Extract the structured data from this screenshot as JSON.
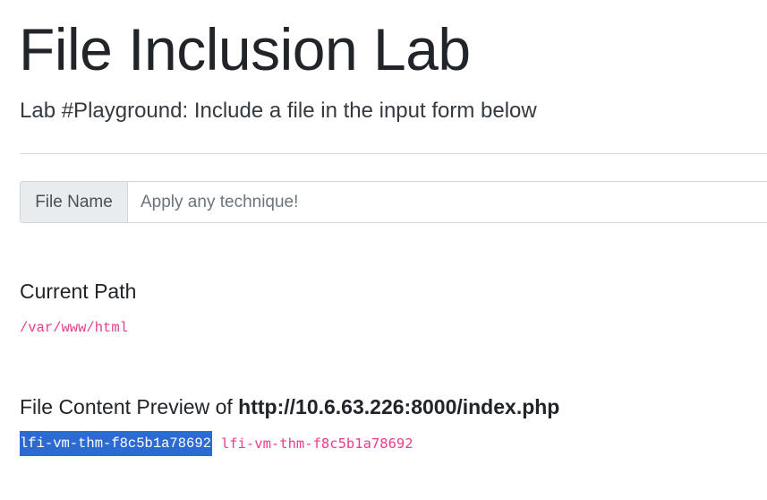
{
  "header": {
    "title": "File Inclusion Lab",
    "subtitle": "Lab #Playground: Include a file in the input form below"
  },
  "form": {
    "label": "File Name",
    "input_value": "",
    "placeholder": "Apply any technique!"
  },
  "current_path": {
    "heading": "Current Path",
    "value": "/var/www/html"
  },
  "preview": {
    "heading_prefix": "File Content Preview of",
    "url": "http://10.6.63.226:8000/index.php",
    "selected_text": "lfi-vm-thm-f8c5b1a78692",
    "content_text": "lfi-vm-thm-f8c5b1a78692"
  },
  "colors": {
    "code": "#e83e8c",
    "selection": "#2c6ad2",
    "addon_background": "#e9ecef"
  }
}
